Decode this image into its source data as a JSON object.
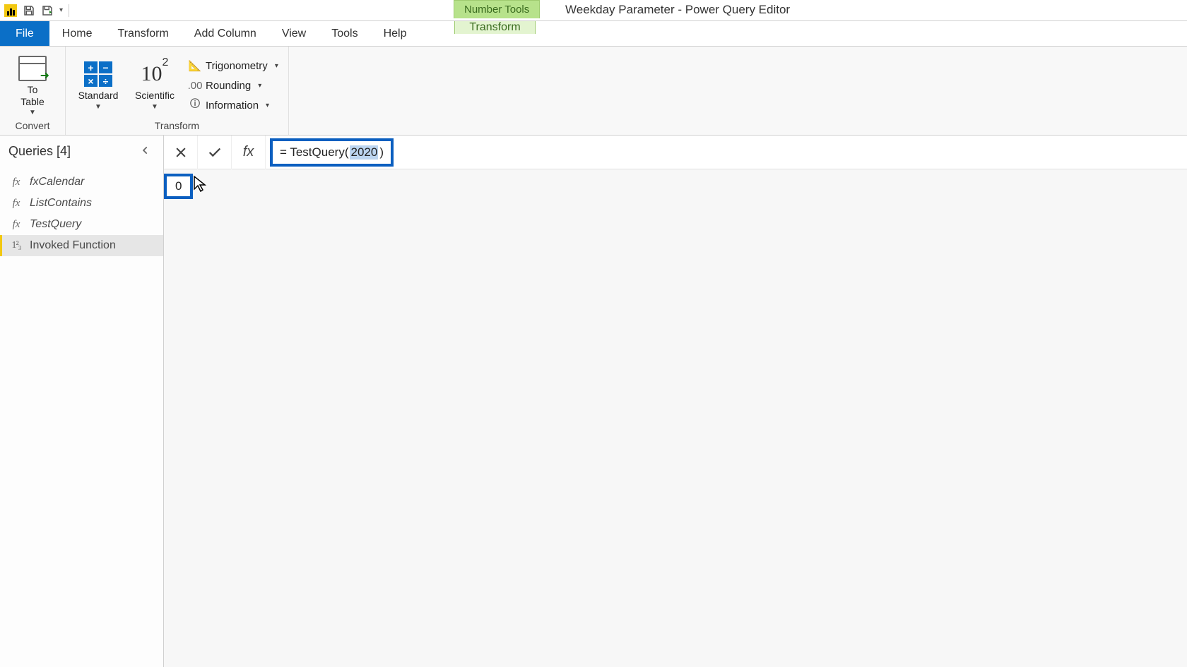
{
  "titlebar": {
    "context_tool_label": "Number Tools",
    "window_title": "Weekday Parameter - Power Query Editor"
  },
  "tabs": {
    "file": "File",
    "home": "Home",
    "transform": "Transform",
    "add_column": "Add Column",
    "view": "View",
    "tools": "Tools",
    "help": "Help",
    "context_transform": "Transform"
  },
  "ribbon": {
    "convert_group": "Convert",
    "to_table": "To\nTable",
    "transform_group": "Transform",
    "standard": "Standard",
    "scientific": "Scientific",
    "trigonometry": "Trigonometry",
    "rounding": "Rounding",
    "information": "Information"
  },
  "queries": {
    "header": "Queries [4]",
    "items": [
      {
        "icon": "fx",
        "label": "fxCalendar"
      },
      {
        "icon": "fx",
        "label": "ListContains"
      },
      {
        "icon": "fx",
        "label": "TestQuery"
      },
      {
        "icon": "1²₃",
        "label": "Invoked Function"
      }
    ]
  },
  "formula": {
    "prefix": "= TestQuery(",
    "selected": "2020",
    "suffix": ")"
  },
  "result": {
    "value": "0"
  }
}
